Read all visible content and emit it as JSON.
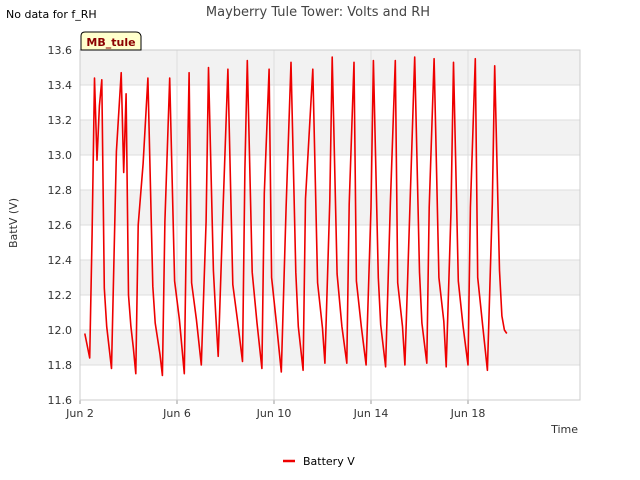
{
  "chart_data": {
    "type": "line",
    "title": "Mayberry Tule Tower: Volts and RH",
    "note": "No data for f_RH",
    "badge": "MB_tule",
    "xlabel": "Time",
    "ylabel": "BattV (V)",
    "ylim": [
      11.6,
      13.6
    ],
    "yticks": [
      "11.6",
      "11.8",
      "12.0",
      "12.2",
      "12.4",
      "12.6",
      "12.8",
      "13.0",
      "13.2",
      "13.4",
      "13.6"
    ],
    "xlim": [
      "2023-06-02",
      "2023-06-20"
    ],
    "xticks": [
      {
        "date": "2023-06-02",
        "label": "Jun 2"
      },
      {
        "date": "2023-06-06",
        "label": "Jun 6"
      },
      {
        "date": "2023-06-10",
        "label": "Jun 10"
      },
      {
        "date": "2023-06-14",
        "label": "Jun 14"
      },
      {
        "date": "2023-06-18",
        "label": "Jun 18"
      }
    ],
    "grid": true,
    "legend_position": "bottom",
    "colors": {
      "series": "#ee0000",
      "band": "#f2f2f2",
      "grid": "#dddddd",
      "badge_bg": "#ffffcc"
    },
    "series": [
      {
        "name": "Battery V",
        "start": "2023-06-02",
        "x_units": "days after start",
        "days": [
          0.2,
          0.4,
          0.5,
          0.6,
          0.7,
          0.8,
          0.9,
          1.0,
          1.1,
          1.3,
          1.5,
          1.7,
          1.8,
          1.9,
          2.0,
          2.1,
          2.2,
          2.3,
          2.4,
          2.6,
          2.8,
          3.0,
          3.1,
          3.3,
          3.4,
          3.5,
          3.7,
          3.9,
          4.1,
          4.3,
          4.4,
          4.5,
          4.6,
          4.8,
          5.0,
          5.2,
          5.3,
          5.5,
          5.6,
          5.7,
          5.9,
          6.1,
          6.3,
          6.5,
          6.7,
          6.8,
          6.9,
          7.1,
          7.3,
          7.5,
          7.6,
          7.8,
          7.9,
          8.1,
          8.3,
          8.5,
          8.7,
          8.9,
          9.0,
          9.2,
          9.3,
          9.6,
          9.8,
          10.0,
          10.1,
          10.3,
          10.4,
          10.6,
          10.8,
          11.0,
          11.1,
          11.3,
          11.4,
          11.6,
          11.8,
          12.0,
          12.1,
          12.3,
          12.4,
          12.6,
          12.8,
          13.0,
          13.1,
          13.3,
          13.4,
          13.6,
          13.8,
          14.0,
          14.1,
          14.3,
          14.4,
          14.6,
          14.8,
          15.0,
          15.1,
          15.3,
          15.4,
          15.6,
          15.8,
          16.0,
          16.1,
          16.3,
          16.4,
          16.6,
          16.8,
          17.0,
          17.1,
          17.3,
          17.4,
          17.5,
          17.6
        ],
        "values": [
          11.98,
          11.84,
          12.55,
          13.44,
          12.97,
          13.28,
          13.43,
          12.24,
          12.02,
          11.78,
          13.02,
          13.47,
          12.9,
          13.35,
          12.2,
          12.02,
          11.9,
          11.75,
          12.6,
          12.95,
          13.44,
          12.25,
          12.04,
          11.86,
          11.74,
          12.62,
          13.44,
          12.28,
          12.06,
          11.75,
          12.7,
          13.47,
          12.27,
          12.06,
          11.8,
          12.62,
          13.5,
          12.34,
          12.08,
          11.85,
          12.7,
          13.49,
          12.26,
          12.05,
          11.82,
          12.92,
          13.54,
          12.33,
          12.04,
          11.78,
          12.78,
          13.49,
          12.3,
          12.04,
          11.76,
          12.7,
          13.53,
          12.33,
          12.02,
          11.77,
          12.75,
          13.49,
          12.27,
          12.01,
          11.81,
          12.74,
          13.56,
          12.32,
          12.02,
          11.81,
          12.72,
          13.53,
          12.28,
          12.02,
          11.8,
          12.7,
          13.54,
          12.3,
          12.03,
          11.79,
          12.73,
          13.54,
          12.27,
          12.02,
          11.8,
          12.68,
          13.56,
          12.33,
          12.04,
          11.81,
          12.7,
          13.55,
          12.3,
          12.05,
          11.79,
          12.68,
          13.53,
          12.28,
          12.02,
          11.8,
          12.7,
          13.55,
          12.3,
          12.03,
          11.77,
          12.72,
          13.51,
          12.34,
          12.08,
          12.0,
          11.98
        ]
      }
    ]
  }
}
